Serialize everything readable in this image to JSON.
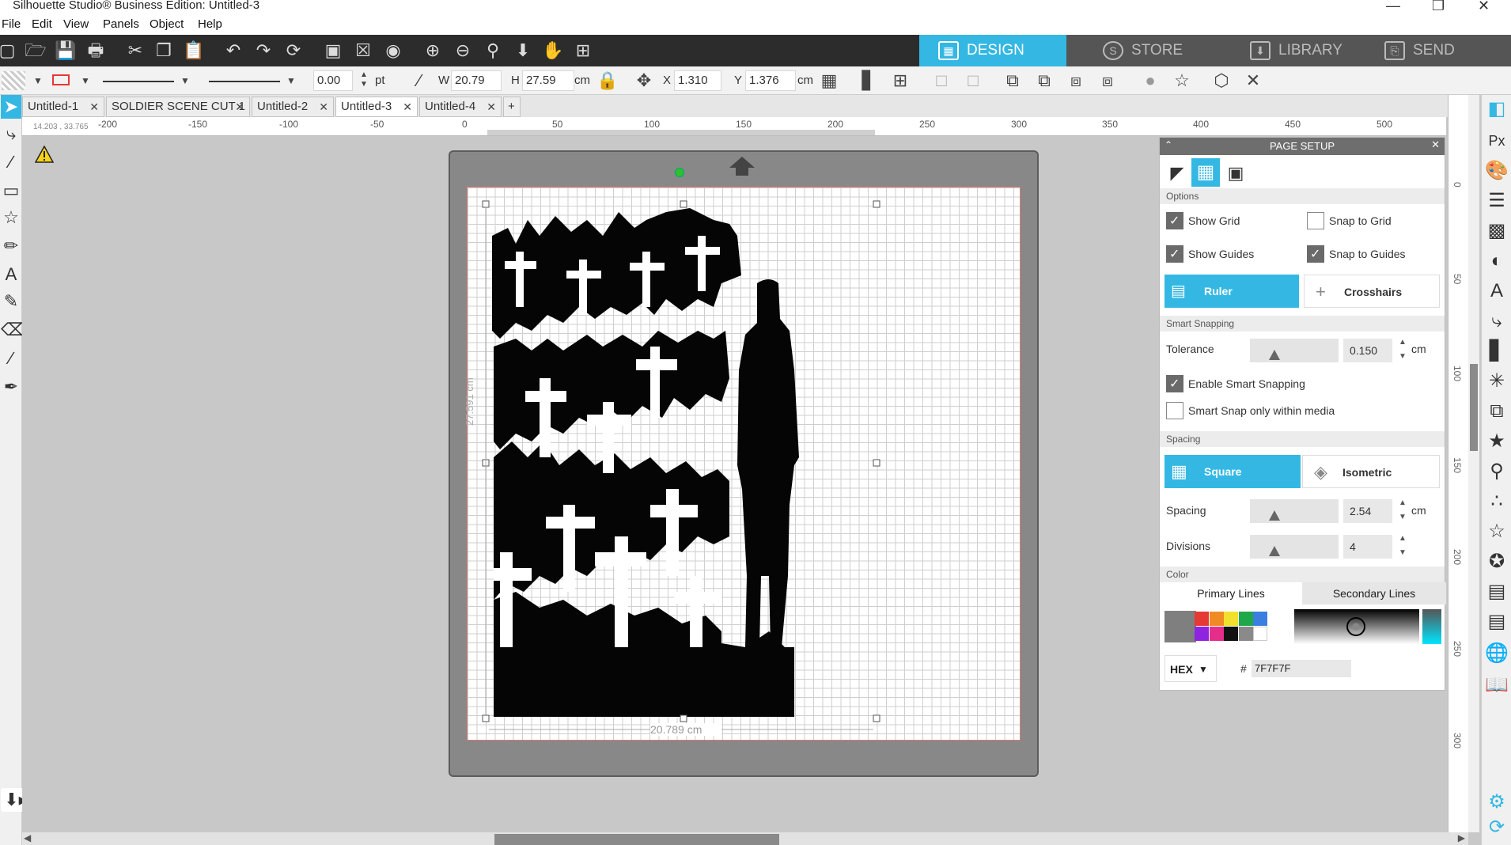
{
  "window": {
    "title": "Silhouette Studio® Business Edition: Untitled-3",
    "minimize": "—",
    "restore": "❐",
    "close": "✕"
  },
  "menu": [
    "File",
    "Edit",
    "View",
    "Panels",
    "Object",
    "Help"
  ],
  "nav_tabs": [
    {
      "label": "DESIGN",
      "icon": "grid-icon",
      "active": true
    },
    {
      "label": "STORE",
      "icon": "store-icon",
      "active": false
    },
    {
      "label": "LIBRARY",
      "icon": "library-icon",
      "active": false
    },
    {
      "label": "SEND",
      "icon": "send-icon",
      "active": false
    }
  ],
  "toolbar2": {
    "line_width": "0.00",
    "line_unit": "pt",
    "w_label": "W",
    "w_value": "20.79",
    "h_label": "H",
    "h_value": "27.59",
    "size_unit": "cm",
    "x_label": "X",
    "x_value": "1.310",
    "y_label": "Y",
    "y_value": "1.376",
    "pos_unit": "cm"
  },
  "doc_tabs": [
    {
      "label": "Untitled-1",
      "active": false
    },
    {
      "label": "SOLDIER SCENE CUT 1",
      "active": false
    },
    {
      "label": "Untitled-2",
      "active": false
    },
    {
      "label": "Untitled-3",
      "active": true
    },
    {
      "label": "Untitled-4",
      "active": false
    }
  ],
  "ruler": {
    "coord": "14.203 , 33.765",
    "h_ticks": [
      "-200",
      "-150",
      "-100",
      "-50",
      "0",
      "50",
      "100",
      "150",
      "200",
      "250",
      "300",
      "350",
      "400",
      "450",
      "500"
    ],
    "v_ticks": [
      "0",
      "50",
      "100",
      "150",
      "200",
      "250",
      "300"
    ]
  },
  "canvas": {
    "height_dim": "27.591 cm",
    "width_dim": "20.789 cm"
  },
  "page_setup": {
    "title": "PAGE SETUP",
    "options_label": "Options",
    "show_grid": "Show Grid",
    "snap_to_grid": "Snap to Grid",
    "show_guides": "Show Guides",
    "snap_to_guides": "Snap to Guides",
    "ruler_btn": "Ruler",
    "crosshairs_btn": "Crosshairs",
    "smart_snapping_label": "Smart Snapping",
    "tolerance_label": "Tolerance",
    "tolerance_value": "0.150",
    "tolerance_unit": "cm",
    "enable_smart_snapping": "Enable Smart Snapping",
    "smart_snap_media": "Smart Snap only within media",
    "spacing_section": "Spacing",
    "square_btn": "Square",
    "isometric_btn": "Isometric",
    "spacing_label": "Spacing",
    "spacing_value": "2.54",
    "spacing_unit": "cm",
    "divisions_label": "Divisions",
    "divisions_value": "4",
    "color_label": "Color",
    "primary_lines": "Primary Lines",
    "secondary_lines": "Secondary Lines",
    "hex_label": "HEX",
    "hash": "#",
    "hex_value": "7F7F7F",
    "checks": {
      "show_grid": true,
      "snap_to_grid": false,
      "show_guides": true,
      "snap_to_guides": true,
      "enable_smart_snapping": true,
      "smart_snap_media": false
    }
  },
  "swatches": [
    "#e53935",
    "#f08a24",
    "#f2e12c",
    "#1fa84a",
    "#3a7fe0",
    "#8e24e0",
    "#e52d8a",
    "#111111",
    "#8a8a8a",
    "#ffffff"
  ],
  "colors": {
    "accent": "#34b8e3",
    "toolbar_dark": "#2c2c2c",
    "grid_color": "#7F7F7F"
  }
}
